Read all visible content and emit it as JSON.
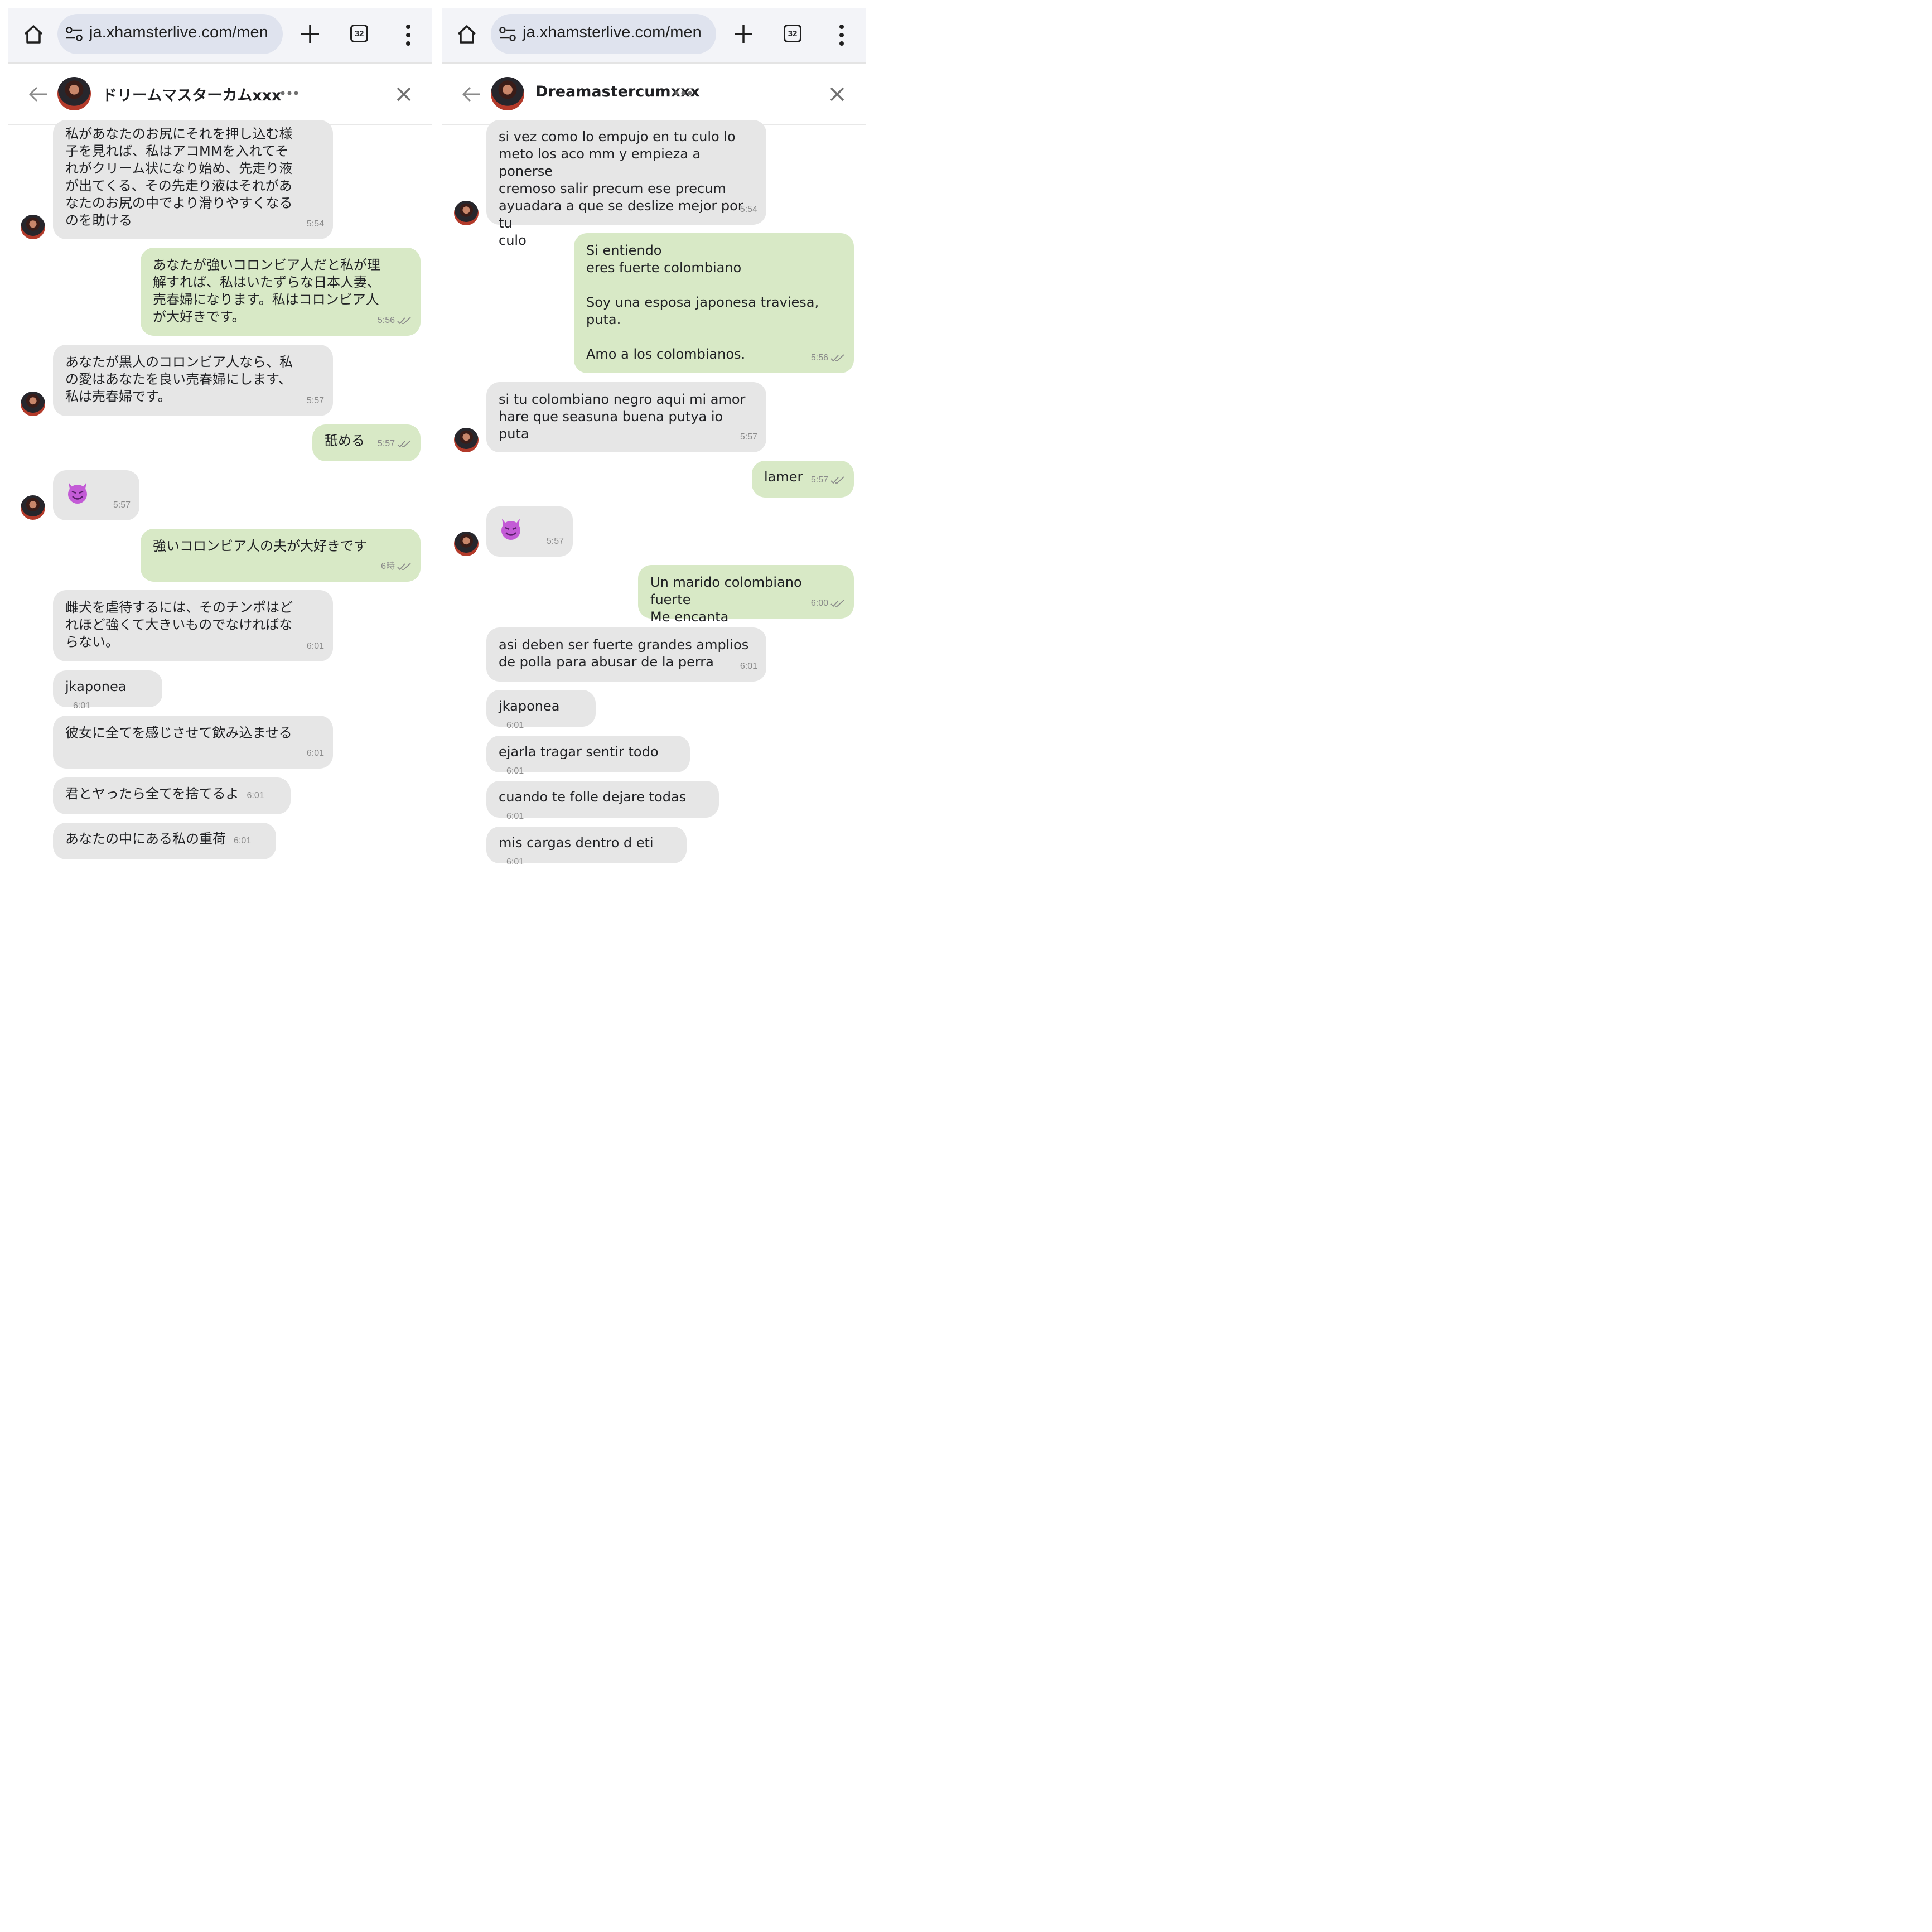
{
  "panels": [
    {
      "browser": {
        "url": "ja.xhamsterlive.com/men",
        "tab_count": "32"
      },
      "chat": {
        "name": "ドリームマスターカムxxx"
      },
      "messages": [
        {
          "dir": "in",
          "text": "私があなたのお尻にそれを押し込む様\n子を見れば、私はアコMMを入れてそ\nれがクリーム状になり始め、先走り液\nが出てくる、その先走り液はそれがあ\nなたのお尻の中でより滑りやすくなる\nのを助ける",
          "time": "5:54"
        },
        {
          "dir": "out",
          "text": "あなたが強いコロンビア人だと私が理\n解すれば、私はいたずらな日本人妻、\n売春婦になります。私はコロンビア人\nが大好きです。",
          "time": "5:56"
        },
        {
          "dir": "in",
          "text": "あなたが黒人のコロンビア人なら、私\nの愛はあなたを良い売春婦にします、\n私は売春婦です。",
          "time": "5:57"
        },
        {
          "dir": "out",
          "text": "舐める",
          "time": "5:57"
        },
        {
          "dir": "in",
          "emoji": "smiling-devil",
          "time": "5:57"
        },
        {
          "dir": "out",
          "text": "強いコロンビア人の夫が大好きです",
          "time": "6時"
        },
        {
          "dir": "in",
          "text": "雌犬を虐待するには、そのチンポはど\nれほど強くて大きいものでなければな\nらない。",
          "time": "6:01"
        },
        {
          "dir": "in",
          "text": "jkaponea",
          "time": "6:01"
        },
        {
          "dir": "in",
          "text": "彼女に全てを感じさせて飲み込ませる",
          "time": "6:01"
        },
        {
          "dir": "in",
          "text": "君とヤったら全てを捨てるよ",
          "time": "6:01"
        },
        {
          "dir": "in",
          "text": "あなたの中にある私の重荷",
          "time": "6:01"
        }
      ]
    },
    {
      "browser": {
        "url": "ja.xhamsterlive.com/men",
        "tab_count": "32"
      },
      "chat": {
        "name": "Dreamastercumxxx"
      },
      "messages": [
        {
          "dir": "in",
          "text": "si vez como lo empujo en tu culo lo\nmeto los aco mm y empieza a ponerse\ncremoso salir precum ese precum\nayuadara a que se deslize mejor por tu\nculo",
          "time": "5:54"
        },
        {
          "dir": "out",
          "text": "Si entiendo\neres fuerte colombiano\n\nSoy una esposa japonesa traviesa,\nputa.\n\nAmo a los colombianos.",
          "time": "5:56"
        },
        {
          "dir": "in",
          "text": "si tu colombiano negro aqui mi amor\nhare que seasuna buena putya io puta",
          "time": "5:57"
        },
        {
          "dir": "out",
          "text": "lamer",
          "time": "5:57"
        },
        {
          "dir": "in",
          "emoji": "smiling-devil",
          "time": "5:57"
        },
        {
          "dir": "out",
          "text": "Un marido colombiano fuerte\nMe encanta",
          "time": "6:00"
        },
        {
          "dir": "in",
          "text": "asi deben ser fuerte grandes amplios\nde polla para abusar de la perra",
          "time": "6:01"
        },
        {
          "dir": "in",
          "text": "jkaponea",
          "time": "6:01"
        },
        {
          "dir": "in",
          "text": "ejarla tragar sentir todo",
          "time": "6:01"
        },
        {
          "dir": "in",
          "text": "cuando te folle dejare todas",
          "time": "6:01"
        },
        {
          "dir": "in",
          "text": "mis cargas dentro d eti",
          "time": "6:01"
        }
      ]
    }
  ],
  "colors": {
    "incoming": "#e6e6e6",
    "outgoing": "#d8e9c6",
    "devil": "#c35bd6"
  }
}
